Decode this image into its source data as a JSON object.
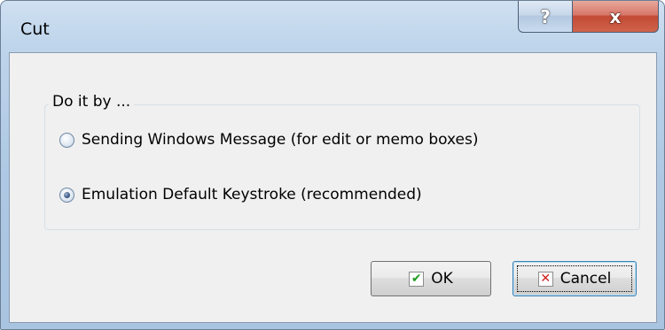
{
  "window": {
    "title": "Cut",
    "help_glyph": "?",
    "close_glyph": "x"
  },
  "group": {
    "label": "Do it by ..."
  },
  "options": [
    {
      "label": "Sending Windows Message (for edit or memo boxes)",
      "selected": false
    },
    {
      "label": "Emulation Default Keystroke (recommended)",
      "selected": true
    }
  ],
  "buttons": {
    "ok_label": "OK",
    "cancel_label": "Cancel",
    "ok_icon": "checkmark-icon",
    "cancel_icon": "x-mark-icon"
  },
  "colors": {
    "check": "#1f9d1f",
    "cross": "#d11c1c",
    "close_button": "#c24a35"
  }
}
